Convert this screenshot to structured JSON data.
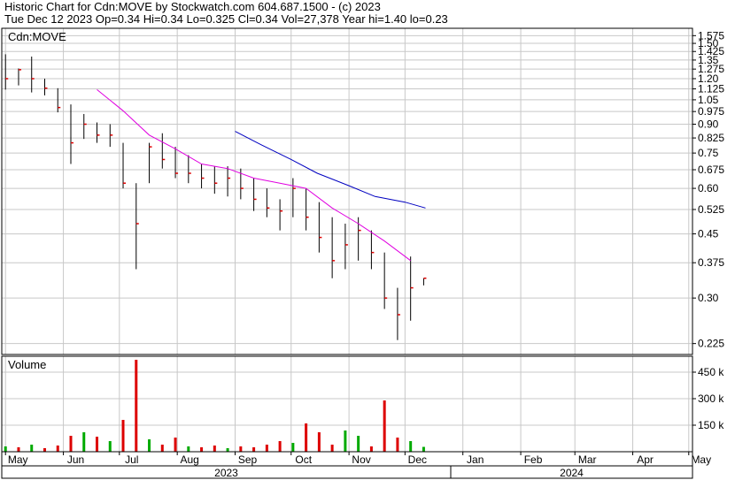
{
  "header": {
    "line1": "Historic Chart for Cdn:MOVE by Stockwatch.com 604.687.1500 - (c) 2023",
    "line2": "Tue Dec 12 2023  Op=0.34  Hi=0.34  Lo=0.325  Cl=0.34  Vol=27,378  Year hi=1.40  lo=0.23"
  },
  "price_panel": {
    "label": "Cdn:MOVE"
  },
  "volume_panel": {
    "label": "Volume"
  },
  "colors": {
    "background": "#ffffff",
    "grid": "#c8c8c8",
    "frame": "#000000",
    "ma_short": "#e000e0",
    "ma_long": "#0000c0",
    "vol_up": "#00aa00",
    "vol_down": "#dd0000",
    "close_tick": "#dd0000"
  },
  "chart_data": [
    {
      "type": "line",
      "title": "Cdn:MOVE",
      "scale": "log",
      "ylim": [
        0.21,
        1.65
      ],
      "ytick_labels": [
        "1.575",
        "1.50",
        "1.425",
        "1.35",
        "1.275",
        "1.20",
        "1.125",
        "1.05",
        "0.975",
        "0.90",
        "0.825",
        "0.75",
        "0.675",
        "0.60",
        "0.525",
        "0.45",
        "0.375",
        "0.30",
        "0.225"
      ],
      "month_labels": [
        "May",
        "Jun",
        "Jul",
        "Aug",
        "Sep",
        "Oct",
        "Nov",
        "Dec",
        "Jan",
        "Feb",
        "Mar",
        "Apr",
        "May"
      ],
      "year_labels": [
        "2023",
        "2024"
      ],
      "grid": true,
      "series": [
        {
          "kind": "ohlc_bars",
          "x": [
            "2023-05-01",
            "2023-05-08",
            "2023-05-15",
            "2023-05-22",
            "2023-05-29",
            "2023-06-05",
            "2023-06-12",
            "2023-06-19",
            "2023-06-26",
            "2023-07-03",
            "2023-07-10",
            "2023-07-17",
            "2023-07-24",
            "2023-07-31",
            "2023-08-07",
            "2023-08-14",
            "2023-08-21",
            "2023-08-28",
            "2023-09-04",
            "2023-09-11",
            "2023-09-18",
            "2023-09-25",
            "2023-10-02",
            "2023-10-09",
            "2023-10-16",
            "2023-10-23",
            "2023-10-30",
            "2023-11-06",
            "2023-11-13",
            "2023-11-20",
            "2023-11-27",
            "2023-12-04",
            "2023-12-11"
          ],
          "high": [
            1.4,
            1.28,
            1.38,
            1.2,
            1.13,
            1.02,
            0.96,
            0.91,
            0.9,
            0.8,
            0.62,
            0.8,
            0.85,
            0.78,
            0.74,
            0.7,
            0.69,
            0.69,
            0.68,
            0.64,
            0.6,
            0.56,
            0.64,
            0.6,
            0.55,
            0.5,
            0.48,
            0.5,
            0.46,
            0.4,
            0.32,
            0.39,
            0.34
          ],
          "low": [
            1.12,
            1.15,
            1.1,
            1.08,
            0.97,
            0.7,
            0.82,
            0.8,
            0.78,
            0.6,
            0.36,
            0.62,
            0.68,
            0.64,
            0.62,
            0.6,
            0.58,
            0.57,
            0.56,
            0.52,
            0.5,
            0.46,
            0.5,
            0.46,
            0.4,
            0.34,
            0.36,
            0.38,
            0.36,
            0.28,
            0.23,
            0.26,
            0.325
          ],
          "close": [
            1.2,
            1.27,
            1.2,
            1.13,
            1.0,
            0.8,
            0.9,
            0.84,
            0.84,
            0.62,
            0.48,
            0.78,
            0.72,
            0.66,
            0.66,
            0.64,
            0.62,
            0.64,
            0.6,
            0.56,
            0.53,
            0.52,
            0.6,
            0.5,
            0.44,
            0.38,
            0.42,
            0.46,
            0.4,
            0.3,
            0.27,
            0.32,
            0.34
          ]
        },
        {
          "kind": "moving_average",
          "x": [
            "2023-06-19",
            "2023-07-03",
            "2023-07-17",
            "2023-07-31",
            "2023-08-14",
            "2023-08-28",
            "2023-09-11",
            "2023-09-25",
            "2023-10-09",
            "2023-10-23",
            "2023-11-06",
            "2023-11-20",
            "2023-12-04"
          ],
          "values": [
            1.12,
            0.98,
            0.84,
            0.77,
            0.7,
            0.68,
            0.64,
            0.62,
            0.6,
            0.53,
            0.48,
            0.43,
            0.38
          ]
        },
        {
          "kind": "moving_average",
          "x": [
            "2023-09-01",
            "2023-09-15",
            "2023-10-01",
            "2023-10-15",
            "2023-11-01",
            "2023-11-15",
            "2023-12-01",
            "2023-12-12"
          ],
          "values": [
            0.86,
            0.79,
            0.72,
            0.66,
            0.61,
            0.57,
            0.55,
            0.53
          ]
        }
      ]
    },
    {
      "type": "bar",
      "title": "Volume",
      "ytick_labels": [
        "450 k",
        "300 k",
        "150 k"
      ],
      "ylim": [
        0,
        540000
      ],
      "x": [
        "2023-05-01",
        "2023-05-08",
        "2023-05-15",
        "2023-05-22",
        "2023-05-29",
        "2023-06-05",
        "2023-06-12",
        "2023-06-19",
        "2023-06-26",
        "2023-07-03",
        "2023-07-10",
        "2023-07-17",
        "2023-07-24",
        "2023-07-31",
        "2023-08-07",
        "2023-08-14",
        "2023-08-21",
        "2023-08-28",
        "2023-09-04",
        "2023-09-11",
        "2023-09-18",
        "2023-09-25",
        "2023-10-02",
        "2023-10-09",
        "2023-10-16",
        "2023-10-23",
        "2023-10-30",
        "2023-11-06",
        "2023-11-13",
        "2023-11-20",
        "2023-11-27",
        "2023-12-04",
        "2023-12-11"
      ],
      "values": [
        30000,
        25000,
        40000,
        20000,
        35000,
        90000,
        110000,
        85000,
        60000,
        180000,
        520000,
        70000,
        40000,
        80000,
        30000,
        25000,
        35000,
        20000,
        30000,
        25000,
        40000,
        60000,
        50000,
        160000,
        110000,
        40000,
        120000,
        90000,
        30000,
        290000,
        80000,
        60000,
        27378
      ],
      "direction": [
        "up",
        "down",
        "up",
        "down",
        "down",
        "down",
        "up",
        "down",
        "up",
        "down",
        "down",
        "up",
        "down",
        "down",
        "up",
        "down",
        "down",
        "up",
        "down",
        "down",
        "down",
        "down",
        "up",
        "down",
        "down",
        "down",
        "up",
        "up",
        "down",
        "down",
        "down",
        "up",
        "up"
      ]
    }
  ]
}
